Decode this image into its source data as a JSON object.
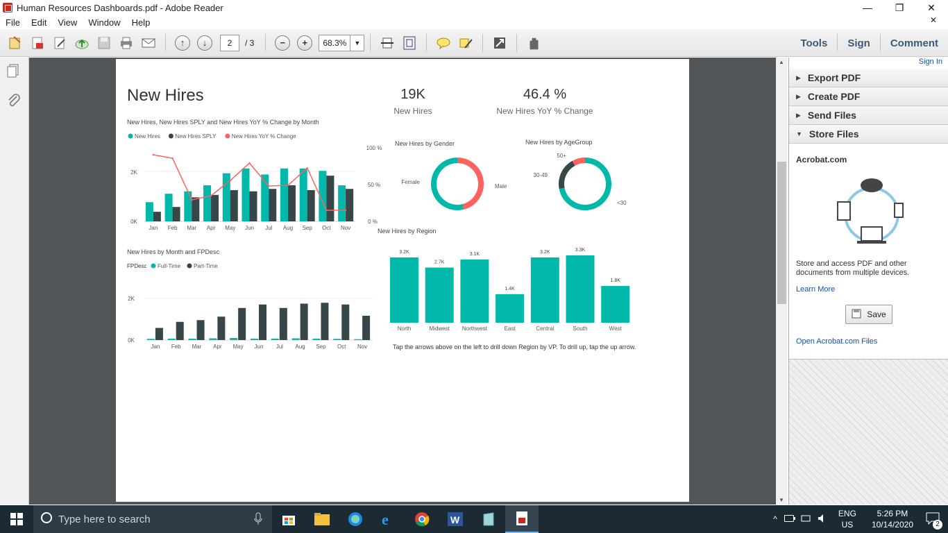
{
  "window": {
    "title": "Human Resources  Dashboards.pdf - Adobe Reader"
  },
  "menu": [
    "File",
    "Edit",
    "View",
    "Window",
    "Help"
  ],
  "toolbar": {
    "page_current": "2",
    "page_total": "/ 3",
    "zoom": "68.3%",
    "right_buttons": [
      "Tools",
      "Sign",
      "Comment"
    ]
  },
  "right_pane": {
    "sign_in": "Sign In",
    "sections": [
      "Export PDF",
      "Create PDF",
      "Send Files",
      "Store Files"
    ],
    "acrobat_title": "Acrobat.com",
    "description": "Store and access PDF and other documents from multiple devices.",
    "learn_more": "Learn More",
    "save_button": "Save",
    "open_link": "Open Acrobat.com Files"
  },
  "dashboard": {
    "title": "New Hires",
    "kpi1": {
      "value": "19K",
      "label": "New Hires"
    },
    "kpi2": {
      "value": "46.4 %",
      "label": "New Hires YoY % Change"
    },
    "footnote": "Tap the arrows above on the left to drill down Region by VP. To drill up, tap the up arrow.",
    "colors": {
      "teal": "#01b8aa",
      "dark": "#374649",
      "red": "#fd625e"
    }
  },
  "chart_data": [
    {
      "type": "bar",
      "title": "New Hires, New Hires SPLY and New Hires YoY % Change by Month",
      "categories": [
        "Jan",
        "Feb",
        "Mar",
        "Apr",
        "May",
        "Jun",
        "Jul",
        "Aug",
        "Sep",
        "Oct",
        "Nov"
      ],
      "series": [
        {
          "name": "New Hires",
          "values": [
            0.8,
            1.15,
            1.25,
            1.5,
            2.0,
            2.2,
            1.95,
            2.2,
            2.2,
            2.1,
            1.5
          ]
        },
        {
          "name": "New Hires SPLY",
          "values": [
            0.4,
            0.6,
            1.0,
            1.1,
            1.3,
            1.25,
            1.35,
            1.5,
            1.3,
            1.9,
            1.35
          ]
        },
        {
          "name": "New Hires YoY % Change",
          "axis": "right",
          "values": [
            92,
            87,
            27,
            33,
            55,
            80,
            47,
            48,
            73,
            12,
            12
          ]
        }
      ],
      "y_ticks": [
        "0K",
        "2K"
      ],
      "y2_ticks": [
        "0 %",
        "50 %",
        "100 %"
      ],
      "ylim": [
        0,
        3
      ],
      "y2lim": [
        0,
        100
      ]
    },
    {
      "type": "pie",
      "title": "New Hires by Gender",
      "labels": [
        "Female",
        "Male"
      ],
      "values": [
        46,
        54
      ]
    },
    {
      "type": "pie",
      "title": "New Hires by AgeGroup",
      "labels": [
        "<30",
        "30-49",
        "50+"
      ],
      "values": [
        72,
        20,
        8
      ]
    },
    {
      "type": "bar",
      "title": "New Hires by Month and FPDesc",
      "legend_title": "FPDesc",
      "categories": [
        "Jan",
        "Feb",
        "Mar",
        "Apr",
        "May",
        "Jun",
        "Jul",
        "Aug",
        "Sep",
        "Oct",
        "Nov"
      ],
      "series": [
        {
          "name": "Full-Time",
          "values": [
            0.07,
            0.08,
            0.08,
            0.1,
            0.12,
            0.08,
            0.08,
            0.1,
            0.08,
            0.07,
            0.05
          ]
        },
        {
          "name": "Part-Time",
          "values": [
            0.7,
            1.05,
            1.15,
            1.35,
            1.85,
            2.05,
            1.85,
            2.1,
            2.15,
            2.05,
            1.4
          ]
        }
      ],
      "y_ticks": [
        "0K",
        "2K"
      ],
      "ylim": [
        0,
        2.8
      ]
    },
    {
      "type": "bar",
      "title": "New Hires by Region",
      "categories": [
        "North",
        "Midwest",
        "Northwest",
        "East",
        "Central",
        "South",
        "West"
      ],
      "values": [
        3.2,
        2.7,
        3.1,
        1.4,
        3.2,
        3.3,
        1.8
      ],
      "data_labels": [
        "3.2K",
        "2.7K",
        "3.1K",
        "1.4K",
        "3.2K",
        "3.3K",
        "1.8K"
      ]
    }
  ],
  "taskbar": {
    "search_placeholder": "Type here to search",
    "lang1": "ENG",
    "lang2": "US",
    "time": "5:26 PM",
    "date": "10/14/2020",
    "notif": "2"
  }
}
